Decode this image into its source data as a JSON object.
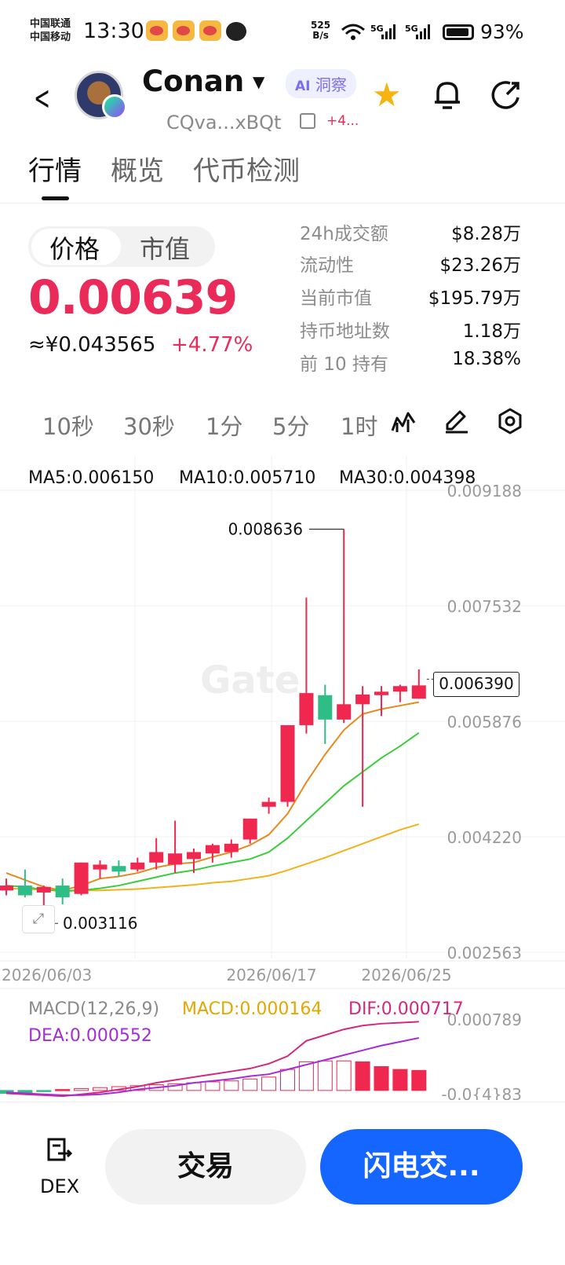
{
  "status_bar": {
    "carrier1": "中国联通",
    "carrier2": "中国移动",
    "time": "13:30",
    "net_speed_value": "525",
    "net_speed_unit": "B/s",
    "signal1": "5G",
    "signal2": "5G",
    "battery": "93%"
  },
  "header": {
    "token_name": "Conan",
    "ai_label": "洞察",
    "ai_prefix": "AI",
    "address": "CQva...xBQt",
    "more_tag": "+4...",
    "star_color": "#f5b412"
  },
  "tabs": [
    {
      "label": "行情",
      "active": true
    },
    {
      "label": "概览",
      "active": false
    },
    {
      "label": "代币检测",
      "active": false
    }
  ],
  "price_panel": {
    "toggle": [
      "价格",
      "市值"
    ],
    "price": "0.00639",
    "cny_price": "≈¥0.043565",
    "change": "+4.77%",
    "up_color": "#ea2b59"
  },
  "stats": [
    {
      "label": "24h成交额",
      "value": "$8.28万"
    },
    {
      "label": "流动性",
      "value": "$23.26万"
    },
    {
      "label": "当前市值",
      "value": "$195.79万"
    },
    {
      "label": "持币地址数",
      "value": "1.18万"
    },
    {
      "label": "前 10 持有",
      "value": "18.38%"
    }
  ],
  "intervals": [
    "10秒",
    "30秒",
    "1分",
    "5分",
    "1时"
  ],
  "toolbar_icons": [
    "indicator-icon",
    "draw-icon",
    "settings-icon"
  ],
  "chart": {
    "ma_labels": [
      "MA5:0.006150",
      "MA10:0.005710",
      "MA30:0.004398"
    ],
    "ma_colors": [
      "#e58a1f",
      "#3bcc3b",
      "#f2b21b"
    ],
    "y_ticks": [
      "0.009188",
      "0.007532",
      "0.005876",
      "0.004220",
      "0.002563"
    ],
    "x_ticks": [
      "2026/06/03",
      "2026/06/17",
      "2026/06/25"
    ],
    "high_label": "0.008636",
    "low_label": "0.003116",
    "last_price": "0.006390",
    "watermark": "Gate",
    "macd_title": "MACD(12,26,9)",
    "macd_value": "MACD:0.000164",
    "dif_value": "DIF:0.000717",
    "dea_value": "DEA:0.000552",
    "macd_axis_top": "0.000789",
    "macd_axis_bottom": "-0.0{4}83"
  },
  "chart_data": {
    "type": "candlestick",
    "y_range": [
      0.002563,
      0.009188
    ],
    "candles": [
      {
        "o": 0.00345,
        "h": 0.00362,
        "l": 0.00338,
        "c": 0.00352
      },
      {
        "o": 0.00352,
        "h": 0.00375,
        "l": 0.00335,
        "c": 0.00338
      },
      {
        "o": 0.00342,
        "h": 0.00352,
        "l": 0.00318,
        "c": 0.0035
      },
      {
        "o": 0.00352,
        "h": 0.00362,
        "l": 0.00325,
        "c": 0.00335
      },
      {
        "o": 0.0034,
        "h": 0.00385,
        "l": 0.00338,
        "c": 0.00385
      },
      {
        "o": 0.00375,
        "h": 0.00388,
        "l": 0.00362,
        "c": 0.00382
      },
      {
        "o": 0.0038,
        "h": 0.00388,
        "l": 0.00365,
        "c": 0.00372
      },
      {
        "o": 0.00375,
        "h": 0.00392,
        "l": 0.00372,
        "c": 0.00385
      },
      {
        "o": 0.00385,
        "h": 0.0042,
        "l": 0.00375,
        "c": 0.004
      },
      {
        "o": 0.00382,
        "h": 0.00445,
        "l": 0.0037,
        "c": 0.00398
      },
      {
        "o": 0.0039,
        "h": 0.00405,
        "l": 0.0037,
        "c": 0.004
      },
      {
        "o": 0.00398,
        "h": 0.00412,
        "l": 0.00385,
        "c": 0.0041
      },
      {
        "o": 0.004,
        "h": 0.00418,
        "l": 0.00392,
        "c": 0.00412
      },
      {
        "o": 0.00418,
        "h": 0.00448,
        "l": 0.00412,
        "c": 0.00448
      },
      {
        "o": 0.00465,
        "h": 0.00478,
        "l": 0.00455,
        "c": 0.00472
      },
      {
        "o": 0.00472,
        "h": 0.00582,
        "l": 0.00465,
        "c": 0.00582
      },
      {
        "o": 0.00582,
        "h": 0.00765,
        "l": 0.0057,
        "c": 0.00628
      },
      {
        "o": 0.00625,
        "h": 0.0064,
        "l": 0.00555,
        "c": 0.0059
      },
      {
        "o": 0.0059,
        "h": 0.00863,
        "l": 0.00585,
        "c": 0.00612
      },
      {
        "o": 0.00612,
        "h": 0.00638,
        "l": 0.00465,
        "c": 0.00626
      },
      {
        "o": 0.00625,
        "h": 0.00638,
        "l": 0.00595,
        "c": 0.0063
      },
      {
        "o": 0.0063,
        "h": 0.0064,
        "l": 0.00615,
        "c": 0.00638
      },
      {
        "o": 0.0062,
        "h": 0.00662,
        "l": 0.0062,
        "c": 0.00639
      }
    ],
    "ma5": [
      0.0037,
      0.0036,
      0.0035,
      0.00345,
      0.00352,
      0.00362,
      0.00365,
      0.0037,
      0.00378,
      0.00383,
      0.00385,
      0.00393,
      0.004,
      0.0041,
      0.00425,
      0.00455,
      0.005,
      0.0054,
      0.00575,
      0.00598,
      0.00605,
      0.0061,
      0.00615
    ],
    "ma10": [
      0.00352,
      0.0035,
      0.00346,
      0.00344,
      0.00345,
      0.00348,
      0.00352,
      0.00358,
      0.00364,
      0.0037,
      0.00374,
      0.0038,
      0.00385,
      0.0039,
      0.004,
      0.0042,
      0.00445,
      0.0047,
      0.00495,
      0.00515,
      0.00535,
      0.00552,
      0.00571
    ],
    "ma30": [
      0.00348,
      0.00347,
      0.00346,
      0.00345,
      0.00345,
      0.00345,
      0.00346,
      0.00347,
      0.00349,
      0.00351,
      0.00353,
      0.00356,
      0.00358,
      0.00362,
      0.00366,
      0.00374,
      0.00383,
      0.00392,
      0.00402,
      0.00412,
      0.00422,
      0.00432,
      0.0044
    ],
    "macd_hist": [
      -3e-05,
      -3e-05,
      -1e-05,
      1e-05,
      2e-05,
      3e-05,
      4e-05,
      5e-05,
      6e-05,
      7e-05,
      8e-05,
      9e-05,
      0.0001,
      0.00012,
      0.00014,
      0.00022,
      0.0003,
      0.00031,
      0.00031,
      0.0003,
      0.00025,
      0.00022,
      0.00021
    ],
    "dif": [
      -3e-05,
      -4e-05,
      -5e-05,
      -6e-05,
      -4e-05,
      -2e-05,
      1e-05,
      4e-05,
      8e-05,
      0.00011,
      0.00014,
      0.00017,
      0.0002,
      0.00023,
      0.00028,
      0.00036,
      0.00052,
      0.00058,
      0.00064,
      0.00068,
      0.0007,
      0.00071,
      0.00072
    ],
    "dea": [
      -2e-05,
      -3e-05,
      -4e-05,
      -5e-05,
      -5e-05,
      -4e-05,
      -2e-05,
      1e-05,
      3e-05,
      5e-05,
      8e-05,
      0.0001,
      0.00012,
      0.00015,
      0.00017,
      0.00022,
      0.00027,
      0.00032,
      0.00037,
      0.00042,
      0.00047,
      0.00051,
      0.00055
    ],
    "macd_range": [
      -0.0001,
      0.000789
    ]
  },
  "bottom_bar": {
    "dex_label": "DEX",
    "trade_label": "交易",
    "flash_label": "闪电交..."
  }
}
